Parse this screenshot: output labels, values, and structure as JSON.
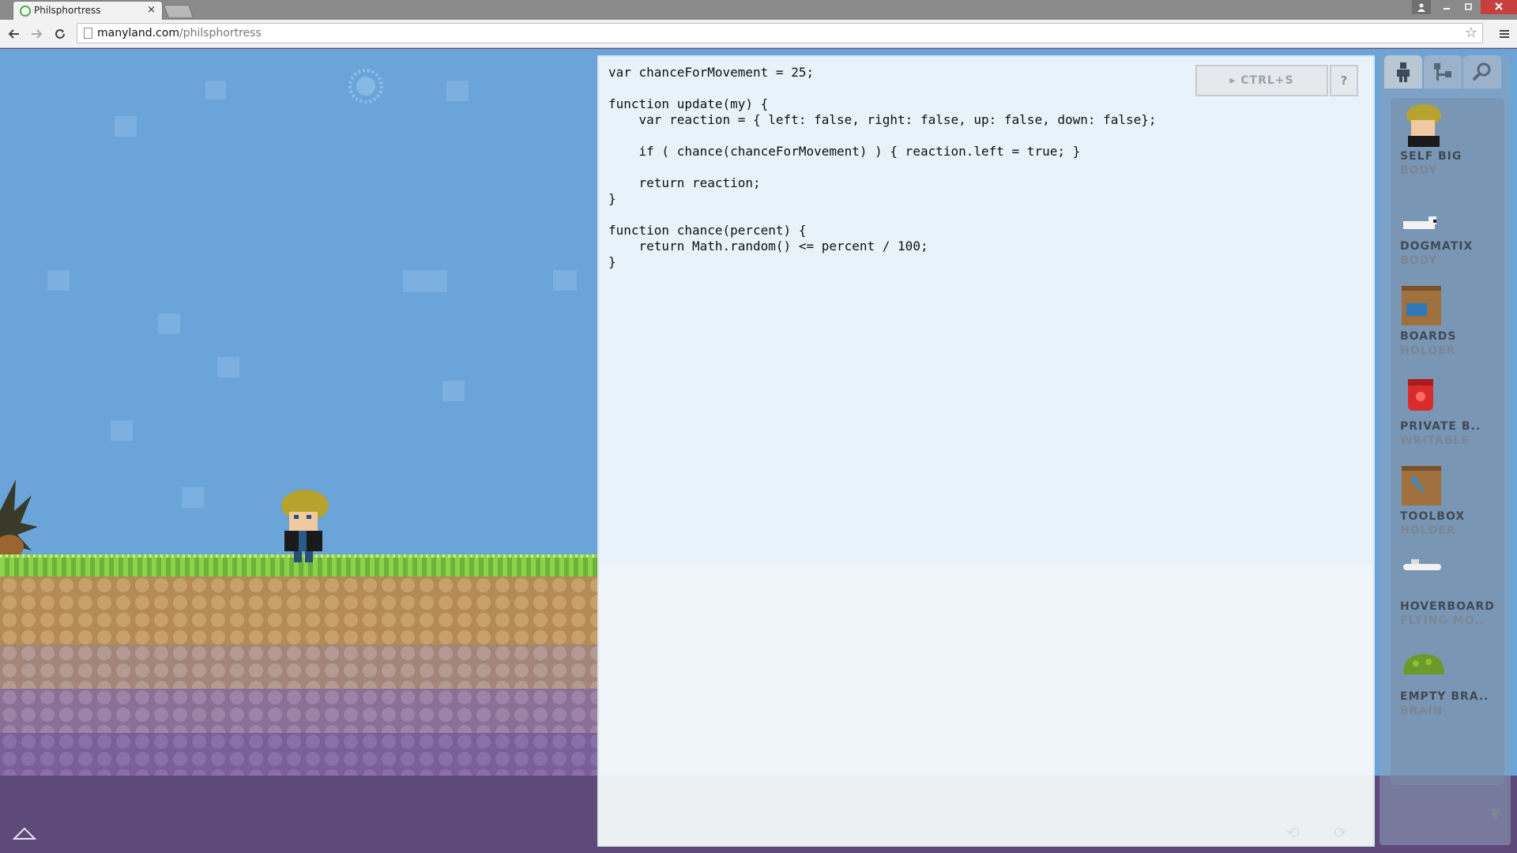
{
  "browser": {
    "tab_title": "Philsphortress",
    "tab_close": "×",
    "url_host": "manyland.com",
    "url_path": "/philsphortress",
    "icons": [
      "favicon-icon",
      "back-arrow-icon",
      "forward-arrow-icon",
      "reload-icon",
      "page-icon",
      "star-icon",
      "menu-icon",
      "user-icon",
      "minimize-icon",
      "maximize-icon",
      "close-icon"
    ]
  },
  "editor": {
    "code": "var chanceForMovement = 25;\n\nfunction update(my) {\n    var reaction = { left: false, right: false, up: false, down: false};\n\n    if ( chance(chanceForMovement) ) { reaction.left = true; }\n\n    return reaction;\n}\n\nfunction chance(percent) {\n    return Math.random() <= percent / 100;\n}",
    "run_label": "▸ CTRL+S",
    "help_label": "?"
  },
  "panel": {
    "tabs": [
      "person-icon",
      "tree-icon",
      "search-icon"
    ],
    "items": [
      {
        "name": "SELF BIG",
        "type": "BODY"
      },
      {
        "name": "DOGMATIX",
        "type": "BODY"
      },
      {
        "name": "BOARDS",
        "type": "HOLDER"
      },
      {
        "name": "PRIVATE B..",
        "type": "WRITABLE"
      },
      {
        "name": "TOOLBOX",
        "type": "HOLDER"
      },
      {
        "name": "HOVERBOARD",
        "type": "FLYING MO.."
      },
      {
        "name": "EMPTY BRA..",
        "type": "BRAIN"
      }
    ],
    "scroll_icon": "▼"
  },
  "colors": {
    "sky": "#6aa4d8",
    "grass": "#8fd14a",
    "deep_ground": "#5d4a7b",
    "close_button": "#c74040"
  }
}
